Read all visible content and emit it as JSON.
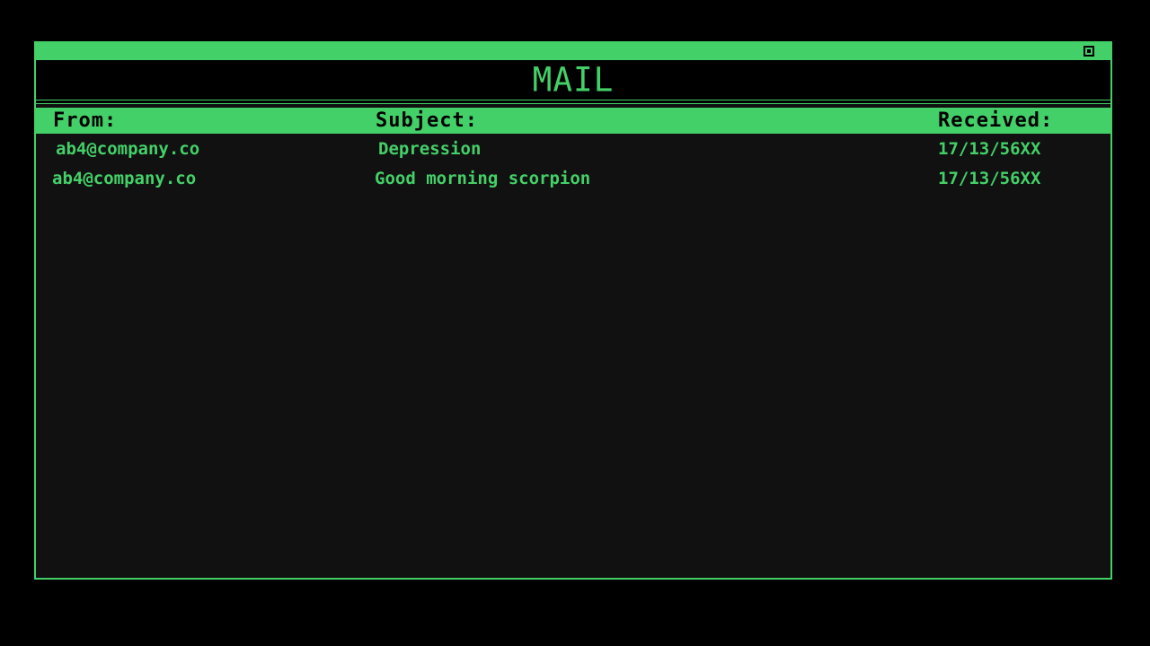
{
  "window": {
    "title": "MAIL",
    "close_icon": "square-close-icon"
  },
  "columns": {
    "from": "From:",
    "subject": "Subject:",
    "received": "Received:"
  },
  "emails": [
    {
      "from": "ab4@company.co",
      "subject": "Depression",
      "received": "17/13/56XX"
    },
    {
      "from": "ab4@company.co",
      "subject": "Good morning scorpion",
      "received": "17/13/56XX"
    }
  ],
  "colors": {
    "accent": "#44d068",
    "background": "#000000",
    "panel": "#111111"
  }
}
